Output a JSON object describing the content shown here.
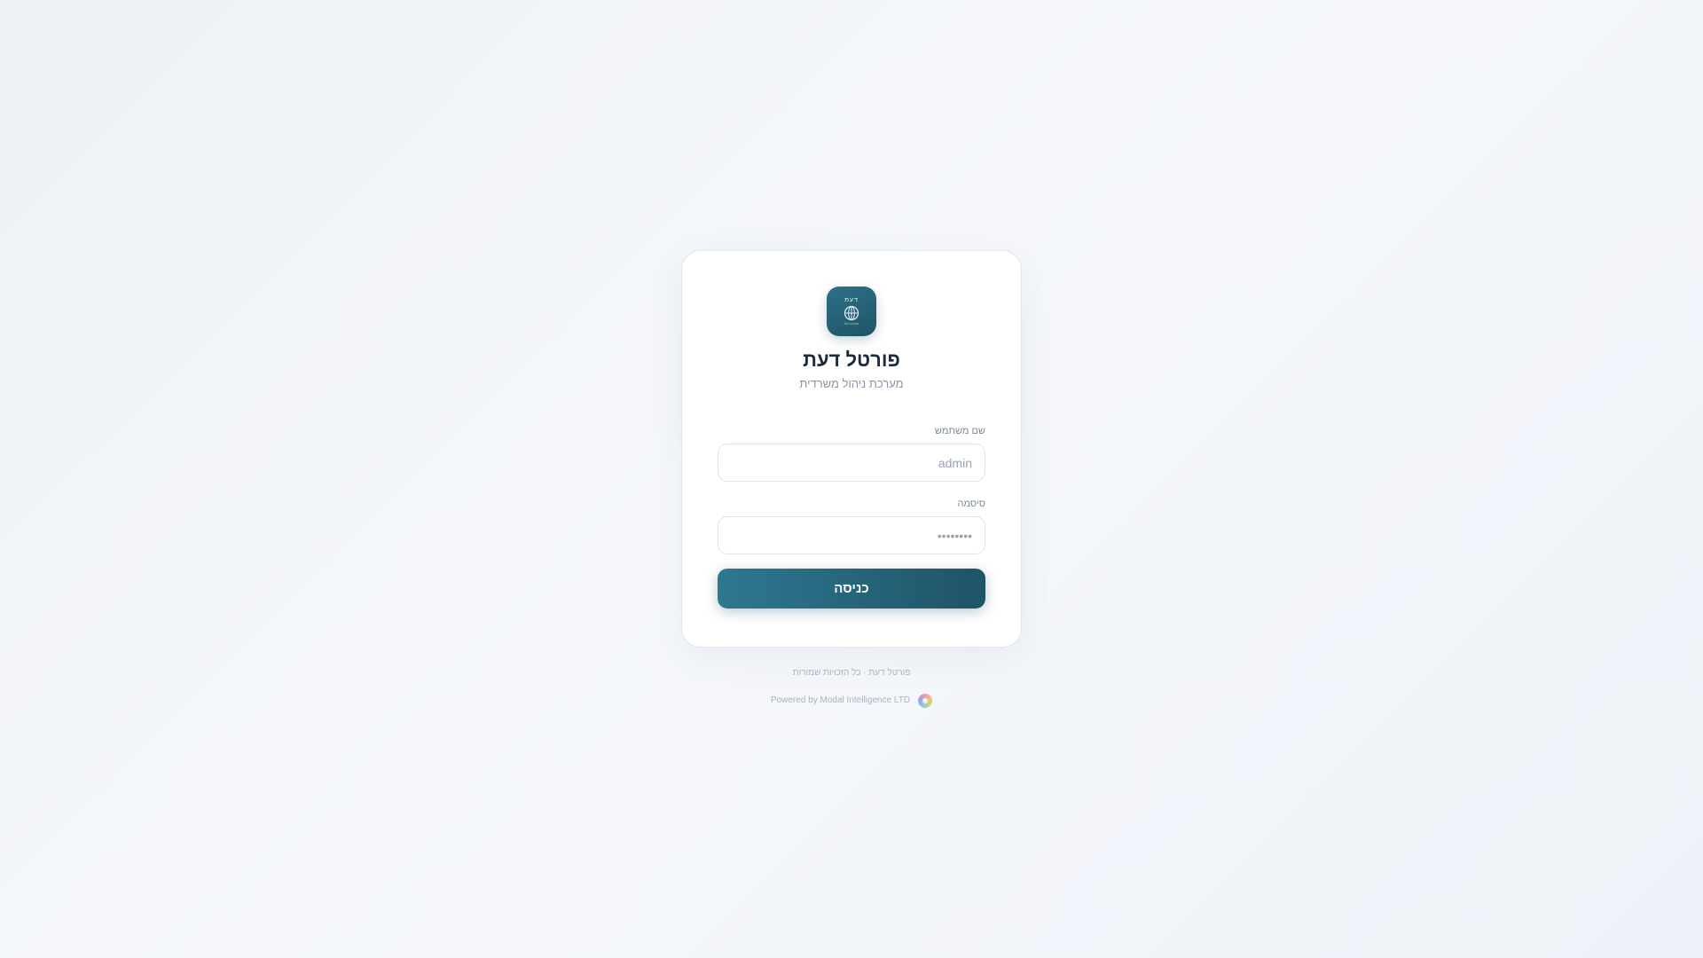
{
  "app": {
    "logo_word": "דעת",
    "logo_tagline": "מערכת ניהול",
    "title": "פורטל דעת",
    "subtitle": "מערכת ניהול משרדית"
  },
  "form": {
    "username_label": "שם משתמש",
    "username_placeholder": "admin",
    "password_label": "סיסמה",
    "password_placeholder": "••••••••",
    "submit_label": "כניסה"
  },
  "footer": {
    "copyright": "פורטל דעת · כל הזכויות שמורות",
    "powered_by": "Powered by Modal Intelligence LTD"
  },
  "icons": {
    "logo": "globe-icon",
    "brand": "modal-intelligence-logo-icon"
  },
  "colors": {
    "accent": "#2e7088",
    "accent_dark": "#1f5366",
    "title": "#1d2a38",
    "muted": "#8a96a6"
  }
}
